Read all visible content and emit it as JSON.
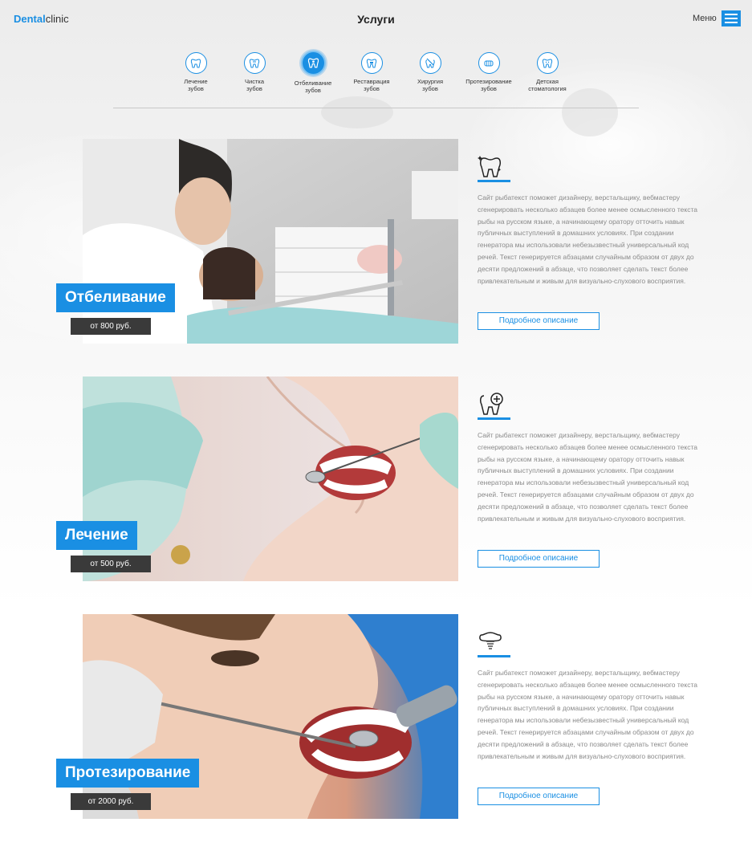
{
  "header": {
    "logo_brand": "Dental",
    "logo_rest": "clinic",
    "title": "Услуги",
    "menu_label": "Меню"
  },
  "services_nav": [
    {
      "line1": "Лечение",
      "line2": "зубов",
      "icon": "tooth-icon",
      "active": false
    },
    {
      "line1": "Чистка",
      "line2": "зубов",
      "icon": "tooth-brush-icon",
      "active": false
    },
    {
      "line1": "Отбеливание",
      "line2": "зубов",
      "icon": "whitening-icon",
      "active": true
    },
    {
      "line1": "Реставрация",
      "line2": "зубов",
      "icon": "tooth-restoration-icon",
      "active": false
    },
    {
      "line1": "Хирургия",
      "line2": "зубов",
      "icon": "surgery-icon",
      "active": false
    },
    {
      "line1": "Протезирование",
      "line2": "зубов",
      "icon": "dentures-icon",
      "active": false
    },
    {
      "line1": "Детская",
      "line2": "стоматология",
      "icon": "child-tooth-icon",
      "active": false
    }
  ],
  "services": [
    {
      "title": "Отбеливание",
      "price": "от 800 руб.",
      "icon": "sparkling-tooth-icon",
      "description": "Сайт рыбатекст поможет дизайнеру, верстальщику, вебмастеру сгенерировать несколько абзацев более менее осмысленного текста рыбы на русском языке, а начинающему оратору отточить навык публичных выступлений в домашних условиях. При создании генератора мы использовали небезызвестный универсальный код речей. Текст генерируется абзацами случайным образом от двух до десяти предложений в абзаце, что позволяет сделать текст более привлекательным и живым для визуально-слухового восприятия.",
      "button": "Подробное описание"
    },
    {
      "title": "Лечение",
      "price": "от 500 руб.",
      "icon": "tooth-plus-icon",
      "description": "Сайт рыбатекст поможет дизайнеру, верстальщику, вебмастеру сгенерировать несколько абзацев более менее осмысленного текста рыбы на русском языке, а начинающему оратору отточить навык публичных выступлений в домашних условиях. При создании генератора мы использовали небезызвестный универсальный код речей. Текст генерируется абзацами случайным образом от двух до десяти предложений в абзаце, что позволяет сделать текст более привлекательным и живым для визуально-слухового восприятия.",
      "button": "Подробное описание"
    },
    {
      "title": "Протезирование",
      "price": "от 2000 руб.",
      "icon": "implant-icon",
      "description": "Сайт рыбатекст поможет дизайнеру, верстальщику, вебмастеру сгенерировать несколько абзацев более менее осмысленного текста рыбы на русском языке, а начинающему оратору отточить навык публичных выступлений в домашних условиях. При создании генератора мы использовали небезызвестный универсальный код речей. Текст генерируется абзацами случайным образом от двух до десяти предложений в абзаце, что позволяет сделать текст более привлекательным и живым для визуально-слухового восприятия.",
      "button": "Подробное описание"
    }
  ],
  "colors": {
    "accent": "#1a8fe3",
    "price_bg": "#3a3a3a",
    "text_muted": "#8a8a8a"
  }
}
